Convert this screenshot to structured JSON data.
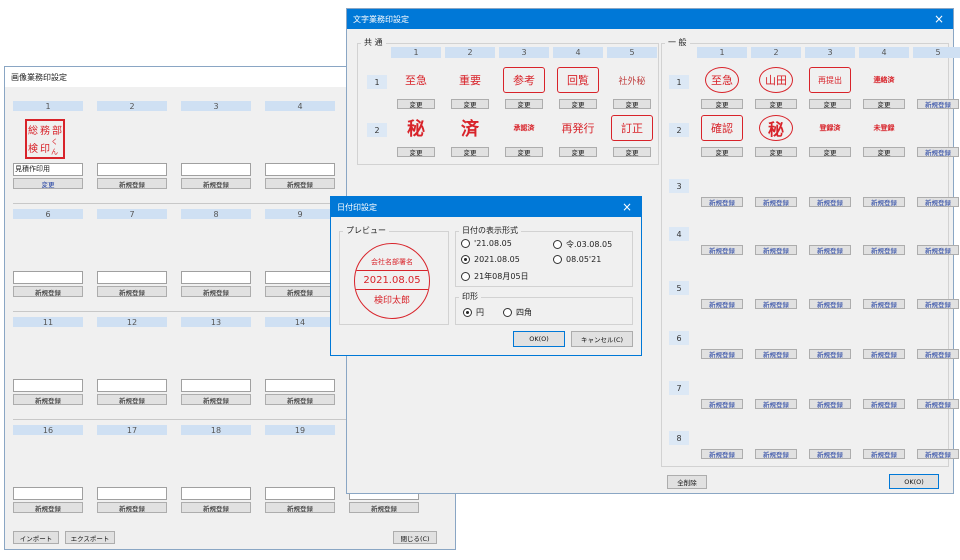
{
  "image_window": {
    "title": "画像業務印設定",
    "slots": [
      {
        "num": "1",
        "name": "見積作印用",
        "button": "変更"
      },
      {
        "num": "2",
        "name": "",
        "button": "新規登録"
      },
      {
        "num": "3",
        "name": "",
        "button": "新規登録"
      },
      {
        "num": "4",
        "name": "",
        "button": "新規登録"
      },
      {
        "num": "6",
        "name": "",
        "button": "新規登録"
      },
      {
        "num": "7",
        "name": "",
        "button": "新規登録"
      },
      {
        "num": "8",
        "name": "",
        "button": "新規登録"
      },
      {
        "num": "9",
        "name": "",
        "button": "新規登録"
      },
      {
        "num": "11",
        "name": "",
        "button": "新規登録"
      },
      {
        "num": "12",
        "name": "",
        "button": "新規登録"
      },
      {
        "num": "13",
        "name": "",
        "button": "新規登録"
      },
      {
        "num": "14",
        "name": "",
        "button": "新規登録"
      },
      {
        "num": "16",
        "name": "",
        "button": "新規登録"
      },
      {
        "num": "17",
        "name": "",
        "button": "新規登録"
      },
      {
        "num": "18",
        "name": "",
        "button": "新規登録"
      },
      {
        "num": "19",
        "name": "",
        "button": "新規登録"
      }
    ],
    "slot20_button": "新規登録",
    "import_label": "インポート",
    "export_label": "エクスポート",
    "close_label": "閉じる(C)",
    "stamp1_lines": [
      "総",
      "務",
      "部",
      "検",
      "印",
      "くん"
    ]
  },
  "text_window": {
    "title": "文字業務印設定",
    "close_symbol": "×",
    "common_label": "共 通",
    "general_label": "一 般",
    "columns": [
      "1",
      "2",
      "3",
      "4",
      "5"
    ],
    "rows": [
      "1",
      "2",
      "3",
      "4",
      "5",
      "6",
      "7",
      "8"
    ],
    "change_label": "変更",
    "new_label": "新規登録",
    "delete_all_label": "全削除",
    "ok_label": "OK(O)",
    "common_stamps": [
      [
        "至急",
        "重要",
        "参考",
        "回覧",
        "社外秘"
      ],
      [
        "秘",
        "済",
        "承認済",
        "再発行",
        "訂正"
      ]
    ],
    "general_stamps": [
      [
        "至急",
        "山田",
        "再提出",
        "連絡済"
      ],
      [
        "確認",
        "秘",
        "登録済",
        "未登録"
      ]
    ]
  },
  "date_dialog": {
    "title": "日付印設定",
    "close_symbol": "×",
    "preview_label": "プレビュー",
    "stamp_top": "会社名部署名",
    "stamp_date": "2021.08.05",
    "stamp_name": "検印太郎",
    "format_label": "日付の表示形式",
    "formats": [
      "'21.08.05",
      "令.03.08.05",
      "2021.08.05",
      "08.05'21",
      "21年08月05日"
    ],
    "selected_format": "2021.08.05",
    "shape_label": "印形",
    "shapes": [
      "円",
      "四角"
    ],
    "selected_shape": "円",
    "ok_label": "OK(O)",
    "cancel_label": "キャンセル(C)"
  },
  "colors": {
    "stamp_red": "#d8232a",
    "header_blue": "#cfe0f3",
    "title_blue": "#0078d7"
  }
}
